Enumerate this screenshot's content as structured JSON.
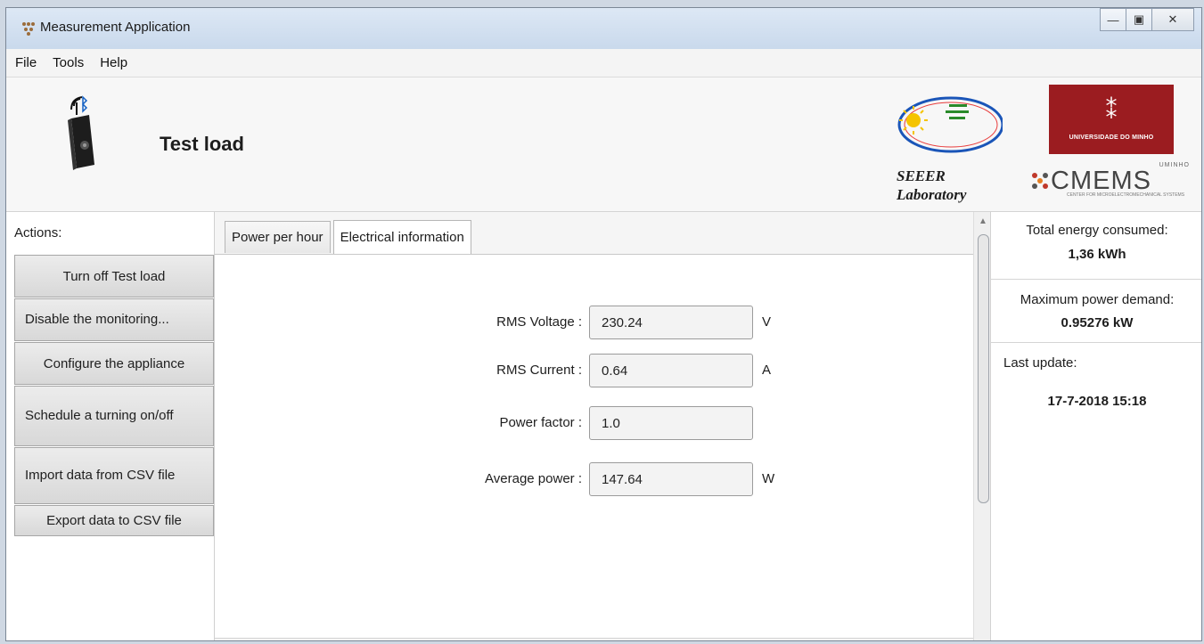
{
  "window": {
    "title": "Measurement Application",
    "controls": {
      "minimize_glyph": "—",
      "maximize_glyph": "▣",
      "close_glyph": "✕"
    }
  },
  "menu": {
    "items": [
      "File",
      "Tools",
      "Help"
    ]
  },
  "header": {
    "title": "Test load",
    "lab_name_line1": "SEEER",
    "lab_name_line2": "Laboratory",
    "university_text": "UNIVERSIDADE DO MINHO",
    "cmems_word": "CMEMS",
    "cmems_small": "UMINHO",
    "cmems_tag": "CENTER FOR MICROELECTROMECHANICAL SYSTEMS"
  },
  "sidebar": {
    "label": "Actions:",
    "buttons": [
      "Turn off Test load",
      "Disable the monitoring...",
      "Configure the appliance",
      "Schedule a turning on/off",
      "Import data from CSV file",
      "Export data to CSV file"
    ]
  },
  "tabs": [
    "Power per hour",
    "Electrical information"
  ],
  "fields": {
    "rms_voltage": {
      "label": "RMS Voltage :",
      "value": "230.24",
      "unit": "V"
    },
    "rms_current": {
      "label": "RMS Current :",
      "value": "0.64",
      "unit": "A"
    },
    "power_factor": {
      "label": "Power factor :",
      "value": "1.0",
      "unit": ""
    },
    "average_power": {
      "label": "Average power :",
      "value": "147.64",
      "unit": "W"
    }
  },
  "info": {
    "energy_label": "Total energy consumed:",
    "energy_value": "1,36 kWh",
    "demand_label": "Maximum power demand:",
    "demand_value": "0.95276 kW",
    "update_label": "Last update:",
    "update_value": "17-7-2018 15:18"
  },
  "colors": {
    "brand_red": "#9b1c20",
    "window_bg": "#f2f2f2"
  }
}
